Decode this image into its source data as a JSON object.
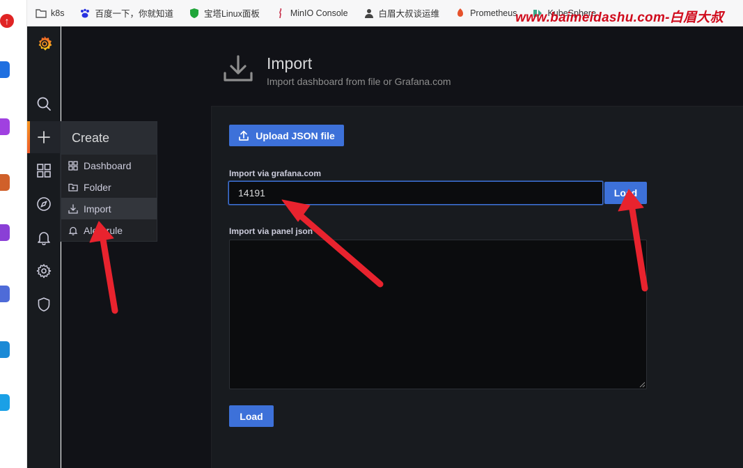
{
  "bookmarks": [
    {
      "label": "k8s",
      "icon": "folder-icon"
    },
    {
      "label": "百度一下，你就知道",
      "icon": "baidu-icon"
    },
    {
      "label": "宝塔Linux面板",
      "icon": "bt-shield-icon"
    },
    {
      "label": "MinIO Console",
      "icon": "minio-icon"
    },
    {
      "label": "白眉大叔谈运维",
      "icon": "avatar-icon"
    },
    {
      "label": "Prometheus",
      "icon": "prometheus-icon"
    },
    {
      "label": "KubeSphere",
      "icon": "kubesphere-icon"
    }
  ],
  "watermark": "www.baimeidashu.com-白眉大叔",
  "sidebar": {
    "icons": [
      "grafana-logo-icon",
      "search-icon",
      "plus-icon",
      "dashboards-icon",
      "explore-icon",
      "alerting-bell-icon",
      "configuration-gear-icon",
      "server-admin-shield-icon"
    ]
  },
  "create_menu": {
    "title": "Create",
    "items": [
      {
        "label": "Dashboard",
        "icon": "dashboard-grid-icon"
      },
      {
        "label": "Folder",
        "icon": "folder-plus-icon"
      },
      {
        "label": "Import",
        "icon": "import-icon"
      },
      {
        "label": "Alert rule",
        "icon": "bell-icon"
      }
    ]
  },
  "page": {
    "title": "Import",
    "subtitle": "Import dashboard from file or Grafana.com"
  },
  "import": {
    "upload_label": "Upload JSON file",
    "grafana_label": "Import via grafana.com",
    "grafana_value": "14191",
    "load_label": "Load",
    "panel_json_label": "Import via panel json",
    "panel_json_value": "",
    "load_bottom_label": "Load"
  },
  "colors": {
    "primary": "#3d71d9",
    "background": "#111217",
    "panel": "#181b1f",
    "annotation_arrow": "#e8232e"
  }
}
